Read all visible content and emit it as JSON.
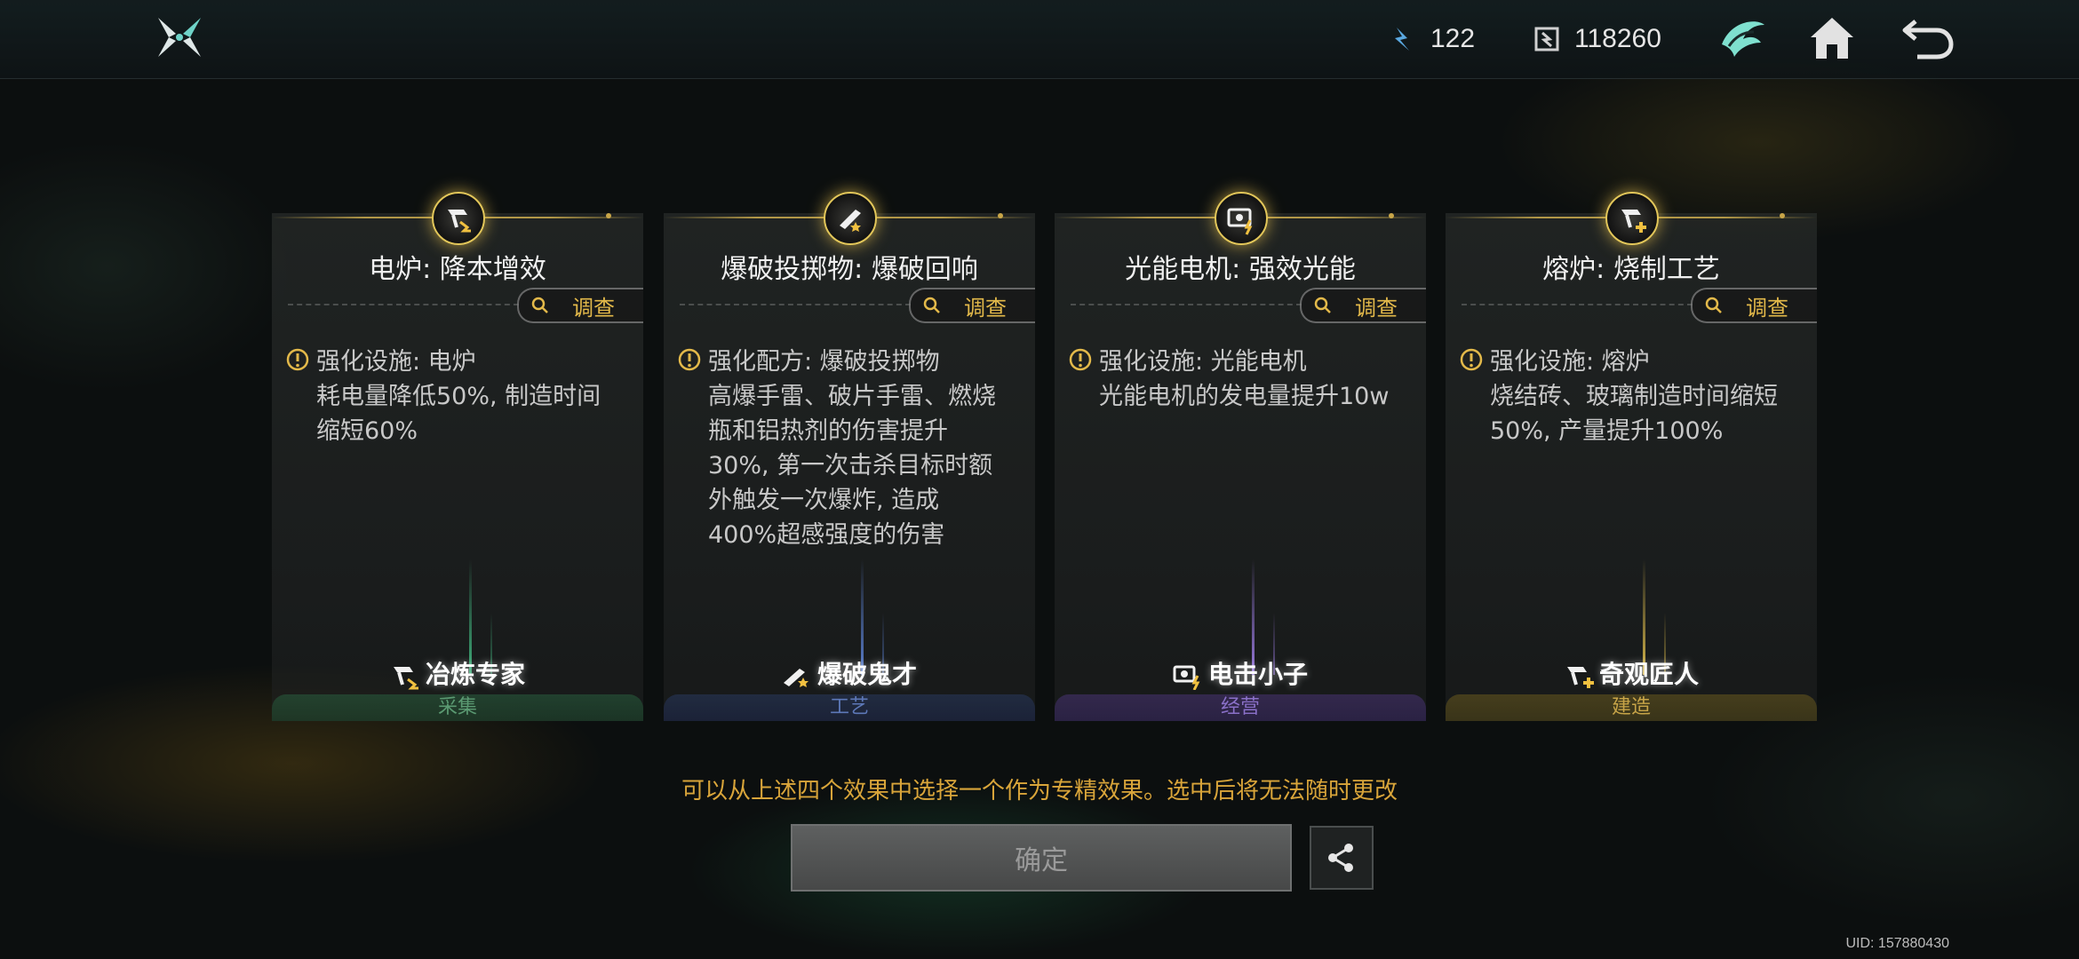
{
  "topbar": {
    "resource1": {
      "icon": "energy-shard-icon",
      "value": "122"
    },
    "resource2": {
      "icon": "crystal-icon",
      "value": "118260"
    }
  },
  "investigate_label": "调查",
  "cards": [
    {
      "title": "电炉: 降本增效",
      "desc_lines": [
        "强化设施: 电炉",
        "耗电量降低50%, 制造时间",
        "缩短60%"
      ],
      "profession": "冶炼专家",
      "category": "采集",
      "accent": "#3fae7a"
    },
    {
      "title": "爆破投掷物: 爆破回响",
      "desc_lines": [
        "强化配方: 爆破投掷物",
        "高爆手雷、破片手雷、燃烧",
        "瓶和铝热剂的伤害提升",
        "30%, 第一次击杀目标时额",
        "外触发一次爆炸, 造成",
        "400%超感强度的伤害"
      ],
      "profession": "爆破鬼才",
      "category": "工艺",
      "accent": "#5a7fd0"
    },
    {
      "title": "光能电机: 强效光能",
      "desc_lines": [
        "强化设施: 光能电机",
        "光能电机的发电量提升10w"
      ],
      "profession": "电击小子",
      "category": "经营",
      "accent": "#9a7ae0"
    },
    {
      "title": "熔炉: 烧制工艺",
      "desc_lines": [
        "强化设施: 熔炉",
        "烧结砖、玻璃制造时间缩短",
        "50%, 产量提升100%"
      ],
      "profession": "奇观匠人",
      "category": "建造",
      "accent": "#d8b84a"
    }
  ],
  "hint": "可以从上述四个效果中选择一个作为专精效果。选中后将无法随时更改",
  "confirm_label": "确定",
  "uid": "UID: 157880430"
}
